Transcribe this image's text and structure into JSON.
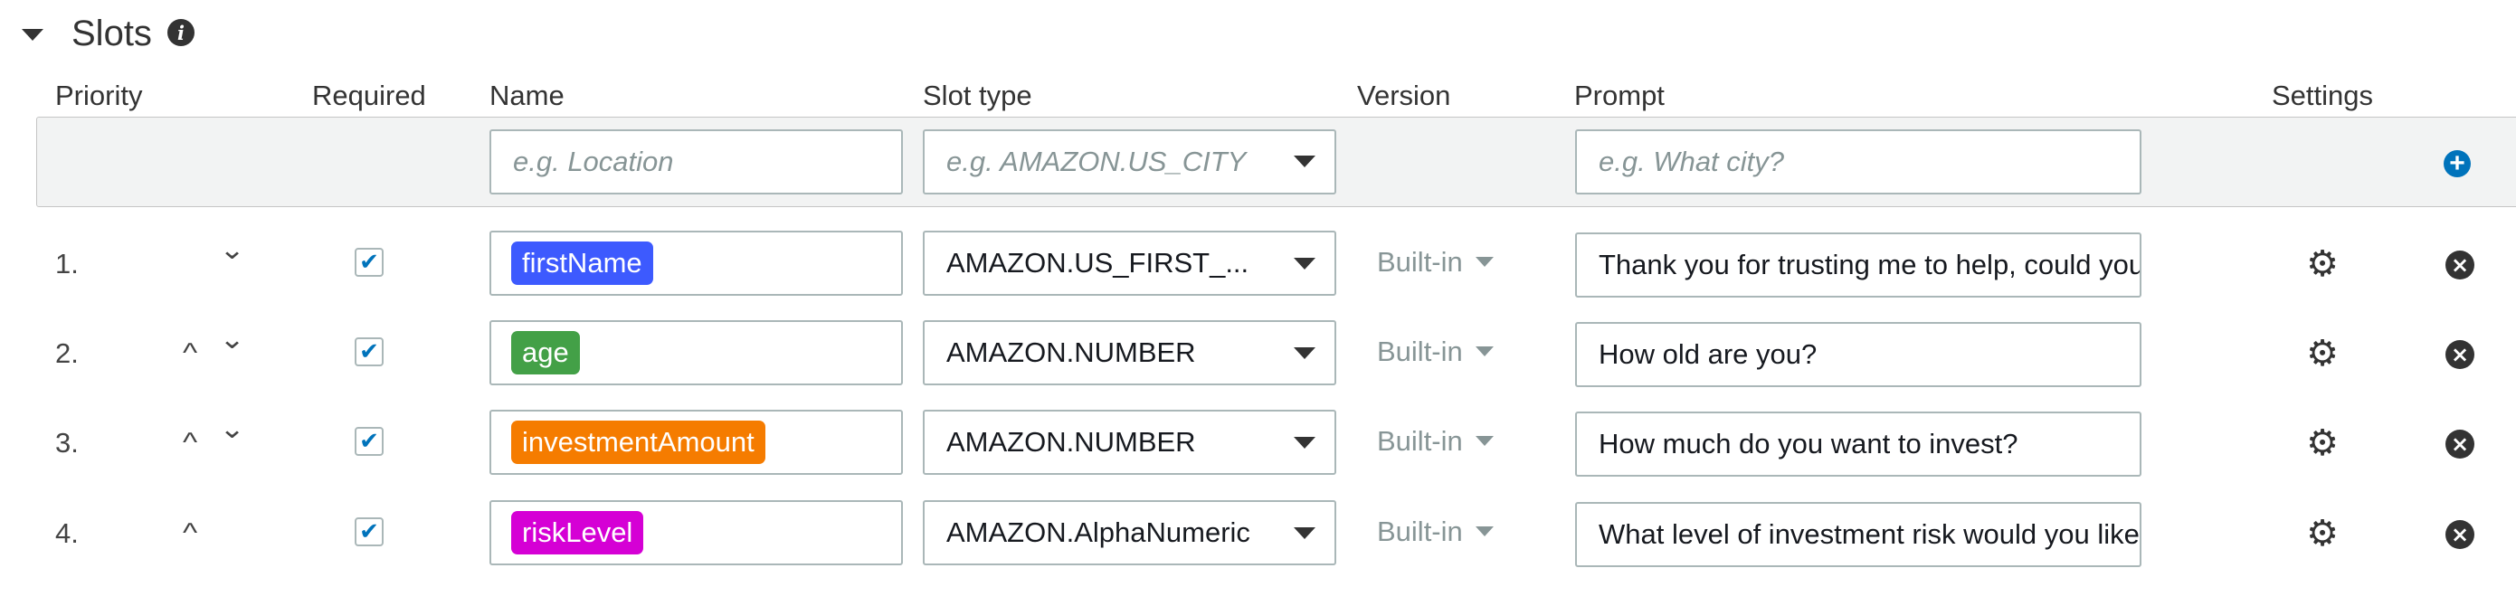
{
  "section": {
    "title": "Slots"
  },
  "columns": {
    "priority": "Priority",
    "required": "Required",
    "name": "Name",
    "slot_type": "Slot type",
    "version": "Version",
    "prompt": "Prompt",
    "settings": "Settings"
  },
  "new_slot": {
    "name_placeholder": "e.g. Location",
    "slot_type_placeholder": "e.g. AMAZON.US_CITY",
    "prompt_placeholder": "e.g. What city?"
  },
  "slots": [
    {
      "number": "1.",
      "required": true,
      "name": "firstName",
      "name_color": "#3d5afe",
      "slot_type": "AMAZON.US_FIRST_...",
      "version": "Built-in",
      "prompt": "Thank you for trusting me to help, could you"
    },
    {
      "number": "2.",
      "required": true,
      "name": "age",
      "name_color": "#43a047",
      "slot_type": "AMAZON.NUMBER",
      "version": "Built-in",
      "prompt": "How old are you?"
    },
    {
      "number": "3.",
      "required": true,
      "name": "investmentAmount",
      "name_color": "#f57c00",
      "slot_type": "AMAZON.NUMBER",
      "version": "Built-in",
      "prompt": "How much do you want to invest?"
    },
    {
      "number": "4.",
      "required": true,
      "name": "riskLevel",
      "name_color": "#d500d5",
      "slot_type": "AMAZON.AlphaNumeric",
      "version": "Built-in",
      "prompt": "What level of investment risk would you like"
    }
  ],
  "glyphs": {
    "chevron_up": "^",
    "chevron_down": "⌄",
    "check": "✔",
    "info": "i",
    "plus": "+",
    "gear": "⚙",
    "close": "×"
  },
  "icons": {
    "section_toggle": "caret-down-icon",
    "info": "info-icon",
    "add": "plus-circle-icon",
    "move_up": "chevron-up-icon",
    "move_down": "chevron-down-icon",
    "settings": "gear-icon",
    "remove": "close-circle-icon"
  }
}
